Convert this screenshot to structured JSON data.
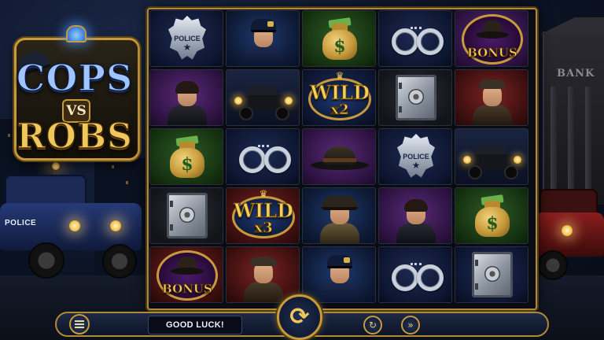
{
  "game": {
    "logo": {
      "line1": "COPS",
      "line2": "VS",
      "line3": "ROBS"
    }
  },
  "scene": {
    "left_car_label": "POLICE",
    "bank_sign": "BANK"
  },
  "reels": {
    "columns": 5,
    "rows": 5,
    "cells": [
      [
        "police-badge",
        "police-officer",
        "money-bag",
        "handcuffs",
        "bonus"
      ],
      [
        "flapper-woman",
        "vintage-car",
        "wild-x2",
        "safe",
        "gangster-flatcap"
      ],
      [
        "money-bag",
        "handcuffs",
        "fedora",
        "police-badge",
        "vintage-car"
      ],
      [
        "safe",
        "wild-x3",
        "detective-fedora",
        "flapper-woman",
        "money-bag"
      ],
      [
        "bonus",
        "gangster-flatcap",
        "police-officer",
        "handcuffs",
        "safe"
      ]
    ],
    "symbol_text": {
      "badge": "POLICE",
      "money": "$",
      "wild_word": "WILD",
      "wild_x2": "x2",
      "wild_x3": "x3",
      "bonus": "BONUS"
    }
  },
  "controls": {
    "message": "GOOD LUCK!",
    "menu_icon": "hamburger-menu-icon",
    "spin_icon": "spin-arrows-icon",
    "autoplay_icon": "autoplay-icon",
    "turbo_icon": "fast-forward-icon"
  },
  "colors": {
    "gold": "#c79a3c",
    "navy": "#0c1426"
  }
}
